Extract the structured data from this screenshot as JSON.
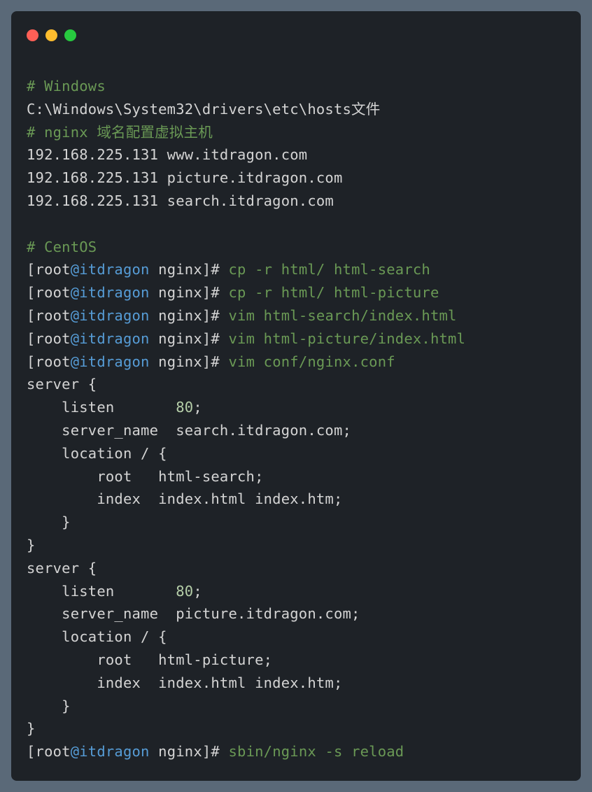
{
  "window_controls": {
    "close": "close",
    "minimize": "minimize",
    "maximize": "maximize"
  },
  "lines": {
    "l1": "# Windows",
    "l2": "C:\\Windows\\System32\\drivers\\etc\\hosts文件",
    "l3": "# nginx 域名配置虚拟主机",
    "l4": "192.168.225.131 www.itdragon.com",
    "l5": "192.168.225.131 picture.itdragon.com",
    "l6": "192.168.225.131 search.itdragon.com",
    "l7": "",
    "l8": "# CentOS",
    "prompt_open": "[",
    "prompt_user": "root",
    "prompt_at": "@",
    "prompt_host": "itdragon",
    "prompt_space": " ",
    "prompt_path": "nginx",
    "prompt_close": "]",
    "prompt_hash": "#",
    "cmd1": " cp -r html/ html-search",
    "cmd2": " cp -r html/ html-picture",
    "cmd3": " vim html-search/index.html",
    "cmd4": " vim html-picture/index.html",
    "cmd5": " vim conf/nginx.conf",
    "cfg1": "server {",
    "cfg2a": "    listen       ",
    "cfg2b": "80",
    "cfg2c": ";",
    "cfg3": "    server_name  search.itdragon.com;",
    "cfg4": "    location / {",
    "cfg5": "        root   html-search;",
    "cfg6": "        index  index.html index.htm;",
    "cfg7": "    }",
    "cfg8": "}",
    "cfg9": "server {",
    "cfg10a": "    listen       ",
    "cfg10b": "80",
    "cfg10c": ";",
    "cfg11": "    server_name  picture.itdragon.com;",
    "cfg12": "    location / {",
    "cfg13": "        root   html-picture;",
    "cfg14": "        index  index.html index.htm;",
    "cfg15": "    }",
    "cfg16": "}",
    "cmd6": " sbin/nginx -s reload"
  }
}
